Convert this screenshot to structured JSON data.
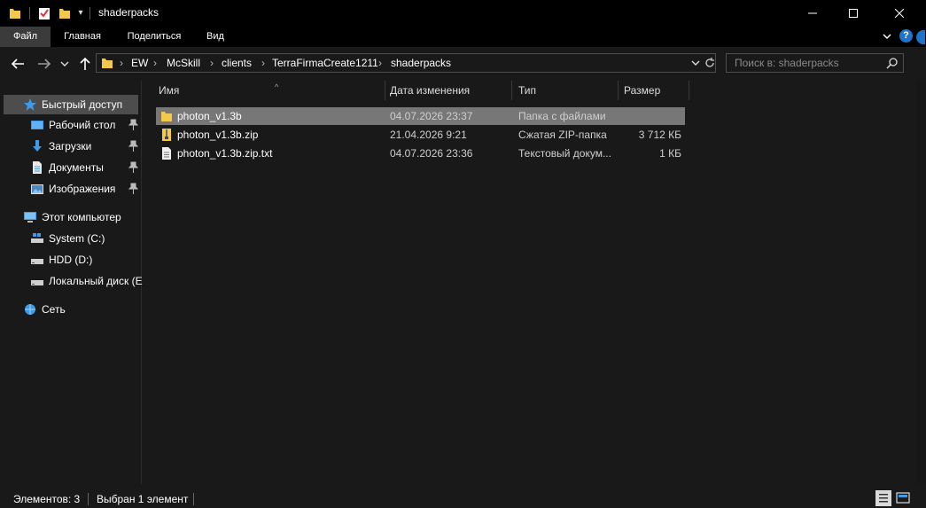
{
  "window": {
    "title": "shaderpacks",
    "controls": {
      "minimize": "—",
      "maximize": "☐",
      "close": "✕"
    }
  },
  "quick_access_toolbar": {
    "icons": [
      "folder-icon",
      "properties-icon",
      "new-folder-icon"
    ],
    "dropdown": "▾"
  },
  "ribbon": {
    "tabs": [
      {
        "label": "Файл",
        "active": true
      },
      {
        "label": "Главная"
      },
      {
        "label": "Поделиться"
      },
      {
        "label": "Вид"
      }
    ],
    "help": "?"
  },
  "navigation": {
    "back": "←",
    "forward": "→",
    "recent": "⌄",
    "up": "↑",
    "path": [
      "EW",
      "McSkill",
      "clients",
      "TerraFirmaCreate1211",
      "shaderpacks"
    ],
    "separator": "›",
    "search_placeholder": "Поиск в: shaderpacks"
  },
  "sidebar": {
    "items": [
      {
        "label": "Быстрый доступ",
        "icon": "star-icon",
        "selected": true,
        "pinned": false
      },
      {
        "label": "Рабочий стол",
        "icon": "desktop-icon",
        "pinned": true
      },
      {
        "label": "Загрузки",
        "icon": "download-icon",
        "pinned": true
      },
      {
        "label": "Документы",
        "icon": "documents-icon",
        "pinned": true
      },
      {
        "label": "Изображения",
        "icon": "pictures-icon",
        "pinned": true
      },
      {
        "label": "Этот компьютер",
        "icon": "computer-icon"
      },
      {
        "label": "System (C:)",
        "icon": "system-drive-icon"
      },
      {
        "label": "HDD (D:)",
        "icon": "drive-icon"
      },
      {
        "label": "Локальный диск (E",
        "icon": "drive-icon"
      },
      {
        "label": "Сеть",
        "icon": "network-icon"
      }
    ]
  },
  "file_list": {
    "columns": [
      "Имя",
      "Дата изменения",
      "Тип",
      "Размер"
    ],
    "sort_indicator": "^",
    "rows": [
      {
        "name": "photon_v1.3b",
        "date": "04.07.2026 23:37",
        "type": "Папка с файлами",
        "size": "",
        "icon": "folder-icon",
        "selected": true
      },
      {
        "name": "photon_v1.3b.zip",
        "date": "21.04.2026 9:21",
        "type": "Сжатая ZIP-папка",
        "size": "3 712 КБ",
        "icon": "zip-icon"
      },
      {
        "name": "photon_v1.3b.zip.txt",
        "date": "04.07.2026 23:36",
        "type": "Текстовый докум...",
        "size": "1 КБ",
        "icon": "text-file-icon"
      }
    ]
  },
  "status_bar": {
    "items_count": "Элементов: 3",
    "selected": "Выбран 1 элемент"
  },
  "colors": {
    "background": "#191919",
    "titlebar": "#000000",
    "selection": "#777777",
    "sidebar_selection": "#4d4d4d",
    "folder": "#f2c94c",
    "accent": "#1e74c9"
  }
}
